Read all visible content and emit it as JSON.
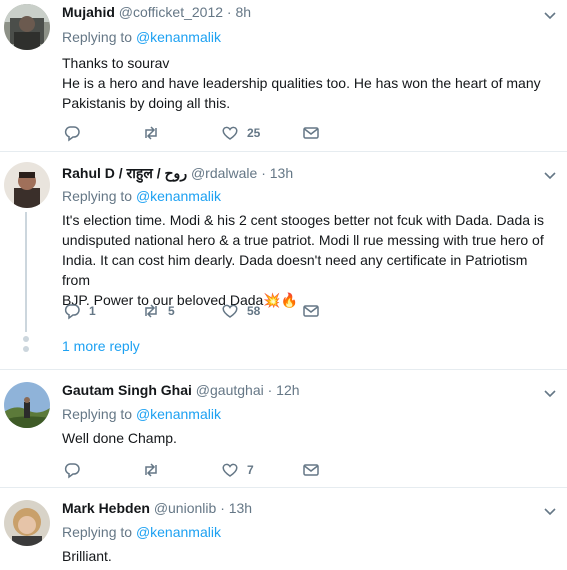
{
  "tweets": [
    {
      "name": "Mujahid",
      "handle": "@cofficket_2012",
      "time": "· 8h",
      "replying_prefix": "Replying to ",
      "replying_to": "@kenanmalik",
      "lines": [
        "Thanks to sourav",
        "He is a hero and have leadership qualities too. He has won the heart of many",
        "Pakistanis by doing all this."
      ],
      "replies": "",
      "retweets": "",
      "likes": "25"
    },
    {
      "name": "Rahul D / राहुल / روح",
      "handle": "@rdalwale",
      "time": "· 13h",
      "replying_prefix": "Replying to ",
      "replying_to": "@kenanmalik",
      "lines": [
        "It's election time. Modi & his 2 cent stooges better not fcuk with Dada. Dada is",
        "undisputed national hero & a true patriot. Modi ll rue messing with true hero of",
        "India. It can cost him dearly. Dada doesn't need any certificate in Patriotism from",
        "BJP. Power to our beloved Dada💥🔥"
      ],
      "replies": "1",
      "retweets": "5",
      "likes": "58",
      "more_replies": "1 more reply"
    },
    {
      "name": "Gautam Singh Ghai",
      "handle": "@gautghai",
      "time": "· 12h",
      "replying_prefix": "Replying to ",
      "replying_to": "@kenanmalik",
      "lines": [
        "Well done Champ."
      ],
      "replies": "",
      "retweets": "",
      "likes": "7"
    },
    {
      "name": "Mark Hebden",
      "handle": "@unionlib",
      "time": "· 13h",
      "replying_prefix": "Replying to ",
      "replying_to": "@kenanmalik",
      "lines": [
        "Brilliant."
      ]
    }
  ],
  "icons": {
    "reply": "reply-icon",
    "retweet": "retweet-icon",
    "like": "heart-icon",
    "dm": "envelope-icon",
    "menu": "chevron-down-icon"
  },
  "colors": {
    "link": "#1da1f2",
    "muted": "#657786",
    "text": "#14171a",
    "divider": "#e6ecf0"
  }
}
